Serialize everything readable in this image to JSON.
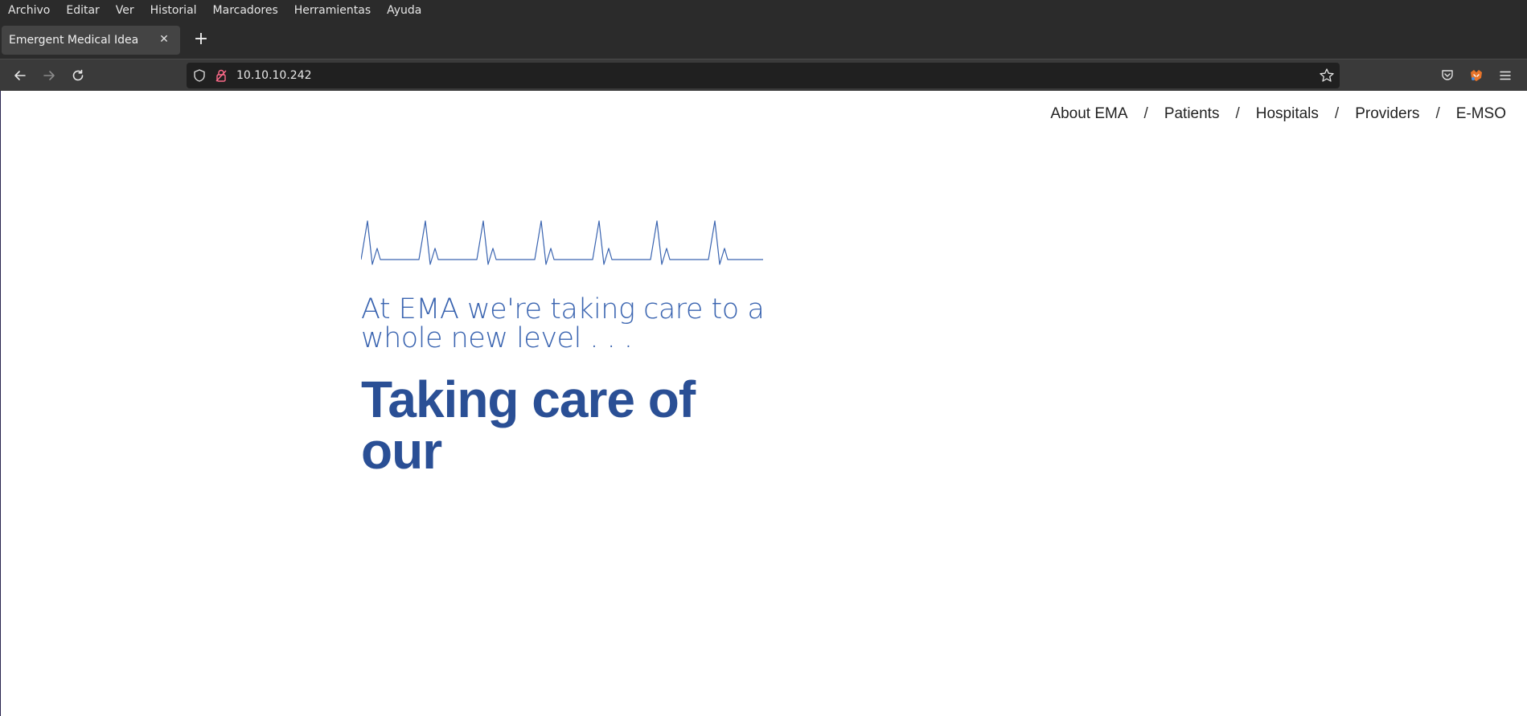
{
  "menubar": {
    "items": [
      "Archivo",
      "Editar",
      "Ver",
      "Historial",
      "Marcadores",
      "Herramientas",
      "Ayuda"
    ]
  },
  "tabs": [
    {
      "title": "Emergent Medical Idea"
    }
  ],
  "toolbar": {
    "url": "10.10.10.242"
  },
  "site": {
    "nav": [
      "About EMA",
      "Patients",
      "Hospitals",
      "Providers",
      "E-MSO"
    ],
    "separator": "/",
    "tagline": "At EMA we're taking care to a whole new level . . .",
    "headline": "Taking care of our"
  },
  "colors": {
    "chrome_dark": "#2b2b2b",
    "accent_blue": "#3a64b0",
    "headline_blue": "#2a4f95"
  }
}
